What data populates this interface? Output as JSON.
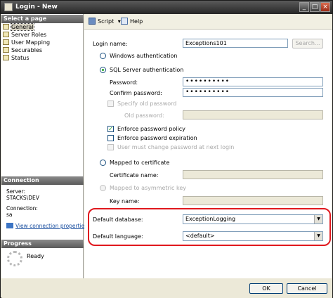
{
  "window": {
    "title": "Login - New",
    "minimize": "_",
    "maximize": "□",
    "close": "×"
  },
  "sidebar": {
    "select_page_header": "Select a page",
    "pages": [
      {
        "label": "General",
        "icon": "page-icon"
      },
      {
        "label": "Server Roles",
        "icon": "page-icon"
      },
      {
        "label": "User Mapping",
        "icon": "page-icon"
      },
      {
        "label": "Securables",
        "icon": "page-icon"
      },
      {
        "label": "Status",
        "icon": "page-icon"
      }
    ],
    "connection_header": "Connection",
    "server_label": "Server:",
    "server_value": "STACKS\\DEV",
    "connection_label": "Connection:",
    "connection_value": "sa",
    "view_connection_link": "View connection properties",
    "progress_header": "Progress",
    "progress_status": "Ready"
  },
  "toolbar": {
    "script_label": "Script",
    "script_arrow": "▾",
    "help_label": "Help"
  },
  "form": {
    "login_name_label": "Login name:",
    "login_name_value": "Exceptions101",
    "search_button": "Search...",
    "windows_auth_label": "Windows authentication",
    "sql_auth_label": "SQL Server authentication",
    "password_label": "Password:",
    "password_value": "••••••••••",
    "confirm_password_label": "Confirm password:",
    "confirm_password_value": "••••••••••",
    "specify_old_password_label": "Specify old password",
    "old_password_label": "Old password:",
    "enforce_policy_label": "Enforce password policy",
    "enforce_policy_checked": true,
    "enforce_expiration_label": "Enforce password expiration",
    "must_change_label": "User must change password at next login",
    "mapped_cert_label": "Mapped to certificate",
    "cert_name_label": "Certificate name:",
    "mapped_key_label": "Mapped to asymmetric key",
    "key_name_label": "Key name:",
    "default_database_label": "Default database:",
    "default_database_value": "ExceptionLogging",
    "default_language_label": "Default language:",
    "default_language_value": "<default>",
    "dropdown_arrow": "▼"
  },
  "buttons": {
    "ok": "OK",
    "cancel": "Cancel"
  },
  "colors": {
    "highlight": "#e0181e",
    "link": "#1a4fa0",
    "check": "#21a121"
  }
}
